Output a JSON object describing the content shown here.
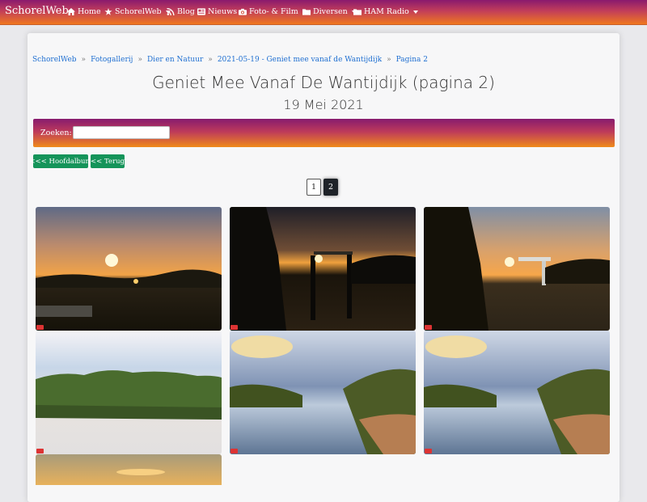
{
  "nav": {
    "brand": "SchorelWeb",
    "items": [
      {
        "label": "Home",
        "icon": "home-icon",
        "dropdown": false
      },
      {
        "label": "SchorelWeb",
        "icon": "star-icon",
        "dropdown": true
      },
      {
        "label": "Blog",
        "icon": "rss-icon",
        "dropdown": false
      },
      {
        "label": "Nieuws",
        "icon": "newspaper-icon",
        "dropdown": false
      },
      {
        "label": "Foto- & Film",
        "icon": "camera-icon",
        "dropdown": true
      },
      {
        "label": "Diversen",
        "icon": "folder-icon",
        "dropdown": true
      },
      {
        "label": "HAM Radio",
        "icon": "folder-icon",
        "dropdown": true
      }
    ]
  },
  "breadcrumb": [
    "SchorelWeb",
    "Fotogallerij",
    "Dier en Natuur",
    "2021-05-19 - Geniet mee vanaf de Wantijdijk",
    "Pagina 2"
  ],
  "breadcrumb_separator": "»",
  "page": {
    "title": "Geniet Mee Vanaf De Wantijdijk (pagina 2)",
    "subtitle": "19 Mei 2021"
  },
  "search": {
    "label": "Zoeken:",
    "value": ""
  },
  "buttons": {
    "main_album": "<<< Hoofdalbum",
    "back": "<< Terug"
  },
  "pagination": {
    "pages": [
      "1",
      "2"
    ],
    "current": "2"
  },
  "colors": {
    "brand_gradient_top": "#8a1a6e",
    "brand_gradient_bottom": "#f0781f",
    "button_green": "#15945a",
    "link_blue": "#1f6fd1"
  },
  "gallery": [
    {
      "scene": "sunset-river"
    },
    {
      "scene": "bridge-silhouette"
    },
    {
      "scene": "bridge-sunset"
    },
    {
      "scene": "green-treeline"
    },
    {
      "scene": "river-reeds"
    },
    {
      "scene": "river-reeds"
    },
    {
      "scene": "sunset-partial"
    }
  ]
}
